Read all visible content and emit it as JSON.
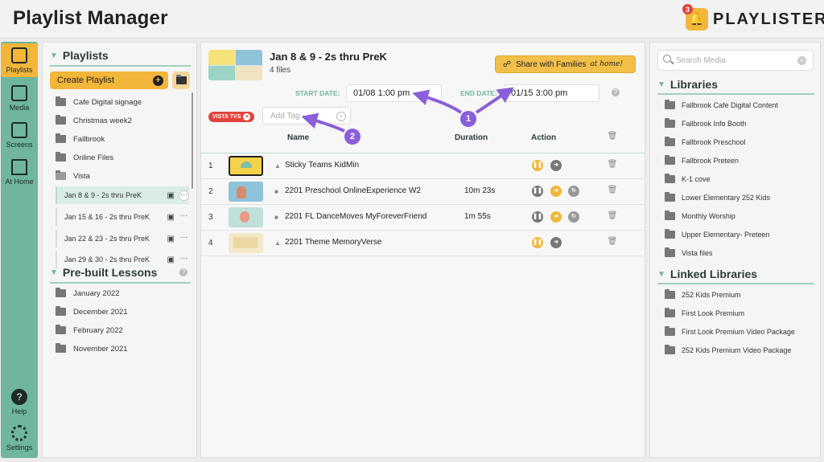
{
  "app": {
    "title": "Playlist Manager",
    "logo_text": "PLAYLISTER",
    "notification_count": "3"
  },
  "nav": [
    {
      "label": "Playlists",
      "icon": "grid-icon"
    },
    {
      "label": "Media",
      "icon": "media-icon"
    },
    {
      "label": "Screens",
      "icon": "screen-icon"
    },
    {
      "label": "At Home",
      "icon": "home-icon"
    },
    {
      "label": "Help",
      "icon": "help-icon"
    },
    {
      "label": "Settings",
      "icon": "gear-icon"
    }
  ],
  "playlists_panel": {
    "heading": "Playlists",
    "create_label": "Create Playlist",
    "folders": [
      "Cafe Digital signage",
      "Christmas week2",
      "Fallbrook",
      "Online Files",
      "Vista"
    ],
    "vista_items": [
      "Jan 8 & 9 - 2s thru PreK",
      "Jan 15 & 16 - 2s thru PreK",
      "Jan 22 & 23 - 2s thru PreK",
      "Jan 29 & 30 - 2s thru PreK"
    ],
    "prebuilt_heading": "Pre-built Lessons",
    "prebuilt": [
      "January 2022",
      "December 2021",
      "February 2022",
      "November 2021"
    ]
  },
  "playlist": {
    "title": "Jan 8 & 9 - 2s thru PreK",
    "files": "4 files",
    "share_label": "Share with Families",
    "share_suffix": "at home!",
    "start_label": "START DATE:",
    "start_value": "01/08 1:00 pm",
    "end_label": "END DATE:",
    "end_value": "01/15 3:00 pm",
    "tag": "VISTA TVS",
    "add_tag_placeholder": "Add Tag",
    "columns": {
      "name": "Name",
      "duration": "Duration",
      "action": "Action"
    },
    "rows": [
      {
        "num": "1",
        "name": "Sticky Teams KidMin",
        "duration": "",
        "type": "image"
      },
      {
        "num": "2",
        "name": "2201 Preschool OnlineExperience W2",
        "duration": "10m 23s",
        "type": "video"
      },
      {
        "num": "3",
        "name": "2201 FL DanceMoves MyForeverFriend",
        "duration": "1m 55s",
        "type": "video"
      },
      {
        "num": "4",
        "name": "2201 Theme MemoryVerse",
        "duration": "",
        "type": "image"
      }
    ]
  },
  "annotations": {
    "one": "1",
    "two": "2"
  },
  "media_panel": {
    "search_placeholder": "Search Media",
    "libraries_heading": "Libraries",
    "libraries": [
      "Fallbrook Cafe Digital Content",
      "Fallbrook Info Booth",
      "Fallbrook Preschool",
      "Fallbrook Preteen",
      "K-1 cove",
      "Lower Elementary 252 Kids",
      "Monthly Worship",
      "Upper Elementary- Preteen",
      "Vista files"
    ],
    "linked_heading": "Linked Libraries",
    "linked": [
      "252 Kids Premium",
      "First Look Premium",
      "First Look Premium Video Package",
      "252 Kids Premium Video Package"
    ]
  },
  "colors": {
    "accent": "#6fb5a0",
    "brand": "#f2b63a",
    "tag": "#e0433b",
    "annotation": "#8a5fd9"
  }
}
